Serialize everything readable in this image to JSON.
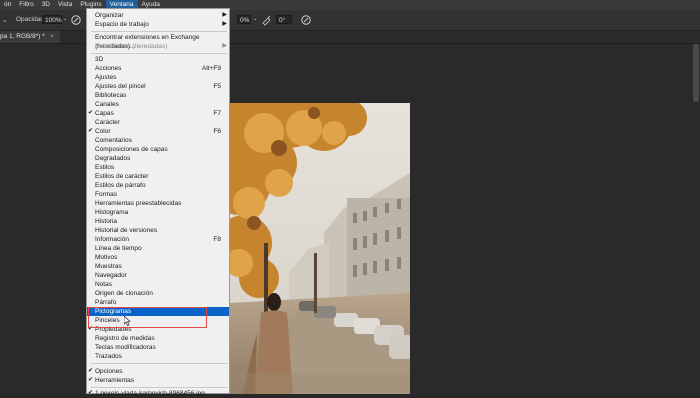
{
  "menubar": {
    "items": [
      "ón",
      "Filtro",
      "3D",
      "Vista",
      "Plugins",
      "Ventana",
      "Ayuda"
    ],
    "active": "Ventana"
  },
  "options_bar": {
    "opacity_label": "Opacidad:",
    "opacity_value": "100%",
    "flow_value": "0%",
    "angle_value": "0°"
  },
  "document_tab": {
    "title": "pa 1, RGB/8*) *",
    "close": "×"
  },
  "window_menu": {
    "items": [
      {
        "label": "Organizar",
        "submenu": true
      },
      {
        "label": "Espacio de trabajo",
        "submenu": true
      },
      {
        "type": "separator"
      },
      {
        "label": "Encontrar extensiones en Exchange (heredadas)..."
      },
      {
        "label": "Extensiones (heredadas)",
        "submenu": true,
        "disabled": true
      },
      {
        "type": "separator"
      },
      {
        "label": "3D"
      },
      {
        "label": "Acciones",
        "shortcut": "Alt+F9"
      },
      {
        "label": "Ajustes"
      },
      {
        "label": "Ajustes del pincel",
        "shortcut": "F5"
      },
      {
        "label": "Bibliotecas"
      },
      {
        "label": "Canales"
      },
      {
        "label": "Capas",
        "shortcut": "F7",
        "checked": true
      },
      {
        "label": "Carácter"
      },
      {
        "label": "Color",
        "shortcut": "F6",
        "checked": true
      },
      {
        "label": "Comentarios"
      },
      {
        "label": "Composiciones de capas"
      },
      {
        "label": "Degradados"
      },
      {
        "label": "Estilos"
      },
      {
        "label": "Estilos de carácter"
      },
      {
        "label": "Estilos de párrafo"
      },
      {
        "label": "Formas"
      },
      {
        "label": "Herramientas preestablecidas"
      },
      {
        "label": "Histograma"
      },
      {
        "label": "Historia"
      },
      {
        "label": "Historial de versiones"
      },
      {
        "label": "Información",
        "shortcut": "F8"
      },
      {
        "label": "Línea de tiempo"
      },
      {
        "label": "Motivos"
      },
      {
        "label": "Muestras"
      },
      {
        "label": "Navegador"
      },
      {
        "label": "Notas"
      },
      {
        "label": "Origen de clonación"
      },
      {
        "label": "Párrafo"
      },
      {
        "label": "Pictogramas",
        "highlighted": true
      },
      {
        "label": "Pinceles"
      },
      {
        "label": "Propiedades",
        "checked": true
      },
      {
        "label": "Registro de medidas"
      },
      {
        "label": "Teclas modificadoras"
      },
      {
        "label": "Trazados"
      },
      {
        "type": "separator"
      },
      {
        "label": "Opciones",
        "checked": true
      },
      {
        "label": "Herramientas",
        "checked": true
      },
      {
        "type": "separator"
      },
      {
        "label": "1 pexels-vlada-karpovich-8968456.jpg",
        "checked": true
      }
    ]
  },
  "colors": {
    "menu_highlight": "#0a64c8",
    "annotation_box": "#e04848",
    "menubar_active": "#1f5f9a"
  }
}
